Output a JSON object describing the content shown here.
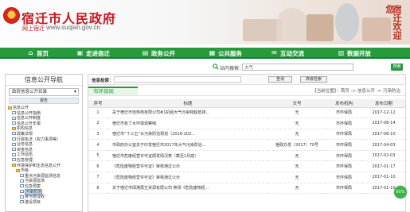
{
  "header": {
    "title": "宿迁市人民政府",
    "subtitle": "网上宿迁",
    "url": "www.suqian.gov.cn",
    "calligraphy": "宿迁欢迎您"
  },
  "nav": [
    {
      "label": "首页",
      "icon": "home-icon"
    },
    {
      "label": "走进宿迁",
      "icon": "photo-icon"
    },
    {
      "label": "政务公开",
      "icon": "document-icon"
    },
    {
      "label": "公共服务",
      "icon": "service-icon"
    },
    {
      "label": "互动交流",
      "icon": "chat-icon"
    },
    {
      "label": "数据开放",
      "icon": "data-icon"
    }
  ],
  "search": {
    "label": "站内搜索：",
    "value": "大气",
    "button": "搜索"
  },
  "sidebar": {
    "title": "信息公开导航",
    "select": "政府信息公开目录",
    "tab": "报告",
    "tree": [
      {
        "label": "信息公开",
        "type": "folder",
        "indent": 0
      },
      {
        "label": "信息公开指南",
        "type": "doc",
        "indent": 1
      },
      {
        "label": "信息公开制度",
        "type": "doc",
        "indent": 1
      },
      {
        "label": "信息公开年报",
        "type": "doc",
        "indent": 1
      },
      {
        "label": "机构信息",
        "type": "folder",
        "indent": 1
      },
      {
        "label": "政策法规",
        "type": "doc",
        "indent": 1
      },
      {
        "label": "行政执法（权力事项等）",
        "type": "doc",
        "indent": 1
      },
      {
        "label": "业务信息",
        "type": "doc",
        "indent": 1
      },
      {
        "label": "资金信息",
        "type": "doc",
        "indent": 1
      },
      {
        "label": "工作动态",
        "type": "doc",
        "indent": 1
      },
      {
        "label": "应急管理",
        "type": "doc",
        "indent": 1
      },
      {
        "label": "环境保护和生态信息公开",
        "type": "folder",
        "indent": 1
      },
      {
        "label": "市级",
        "type": "folder",
        "indent": 2
      },
      {
        "label": "重点污染源监测信息",
        "type": "doc",
        "indent": 3
      },
      {
        "label": "污染源监测",
        "type": "doc",
        "indent": 3
      },
      {
        "label": "应急预案",
        "type": "doc",
        "indent": 3
      },
      {
        "label": "污染防治",
        "type": "doc",
        "indent": 3,
        "selected": true
      },
      {
        "label": "排污费征收",
        "type": "doc",
        "indent": 3
      },
      {
        "label": "建设项目",
        "type": "doc",
        "indent": 3
      }
    ]
  },
  "main": {
    "topbar_label": "信息检索：",
    "btn_query": "查询",
    "btn_advanced": "高级检索",
    "section_tab": "市环保局",
    "breadcrumb": "【当前位置】：首页 -> 信息公开 -> 污染防治",
    "columns": [
      "序号",
      "标题",
      "文号",
      "发布机构",
      "发布日期"
    ],
    "rows": [
      {
        "num": "1",
        "title": "关于宿迁市佳热电有限公司#1机组大气污染物超低排...",
        "fw": "无",
        "org": "市环保局",
        "date": "2017-12-12"
      },
      {
        "num": "2",
        "title": "宿迁市有了水环境观察哨",
        "fw": "无",
        "org": "市环保局",
        "date": "2017-08-14"
      },
      {
        "num": "3",
        "title": "宿迁市“十三五”水污染防治规划（2016-202...",
        "fw": "无",
        "org": "市环保局",
        "date": "2017-08-10"
      },
      {
        "num": "4",
        "title": "市政府办公室关于印发宿迁市2017年大气污染防治...",
        "fw": "宿政办发（2017）70号",
        "org": "市环保局",
        "date": "2017-04-03"
      },
      {
        "num": "5",
        "title": "宿迁市危废经营许可证颁发情况表（截至1月底）",
        "fw": "无",
        "org": "市环保局",
        "date": "2017-02-03"
      },
      {
        "num": "6",
        "title": "《危险废物经营许可证》审核通过公示",
        "fw": "无",
        "org": "市环保局",
        "date": "2017-01-17"
      },
      {
        "num": "7",
        "title": "《危险废物经营许可证》审核通过公示",
        "fw": "无",
        "org": "市环保局",
        "date": "2017-01-10"
      },
      {
        "num": "8",
        "title": "关于宿迁市绿港再生资源有限公司 换领《危险废物经...",
        "fw": "无",
        "org": "市环保局",
        "date": "2017-01-10"
      }
    ]
  },
  "badge": "60%"
}
